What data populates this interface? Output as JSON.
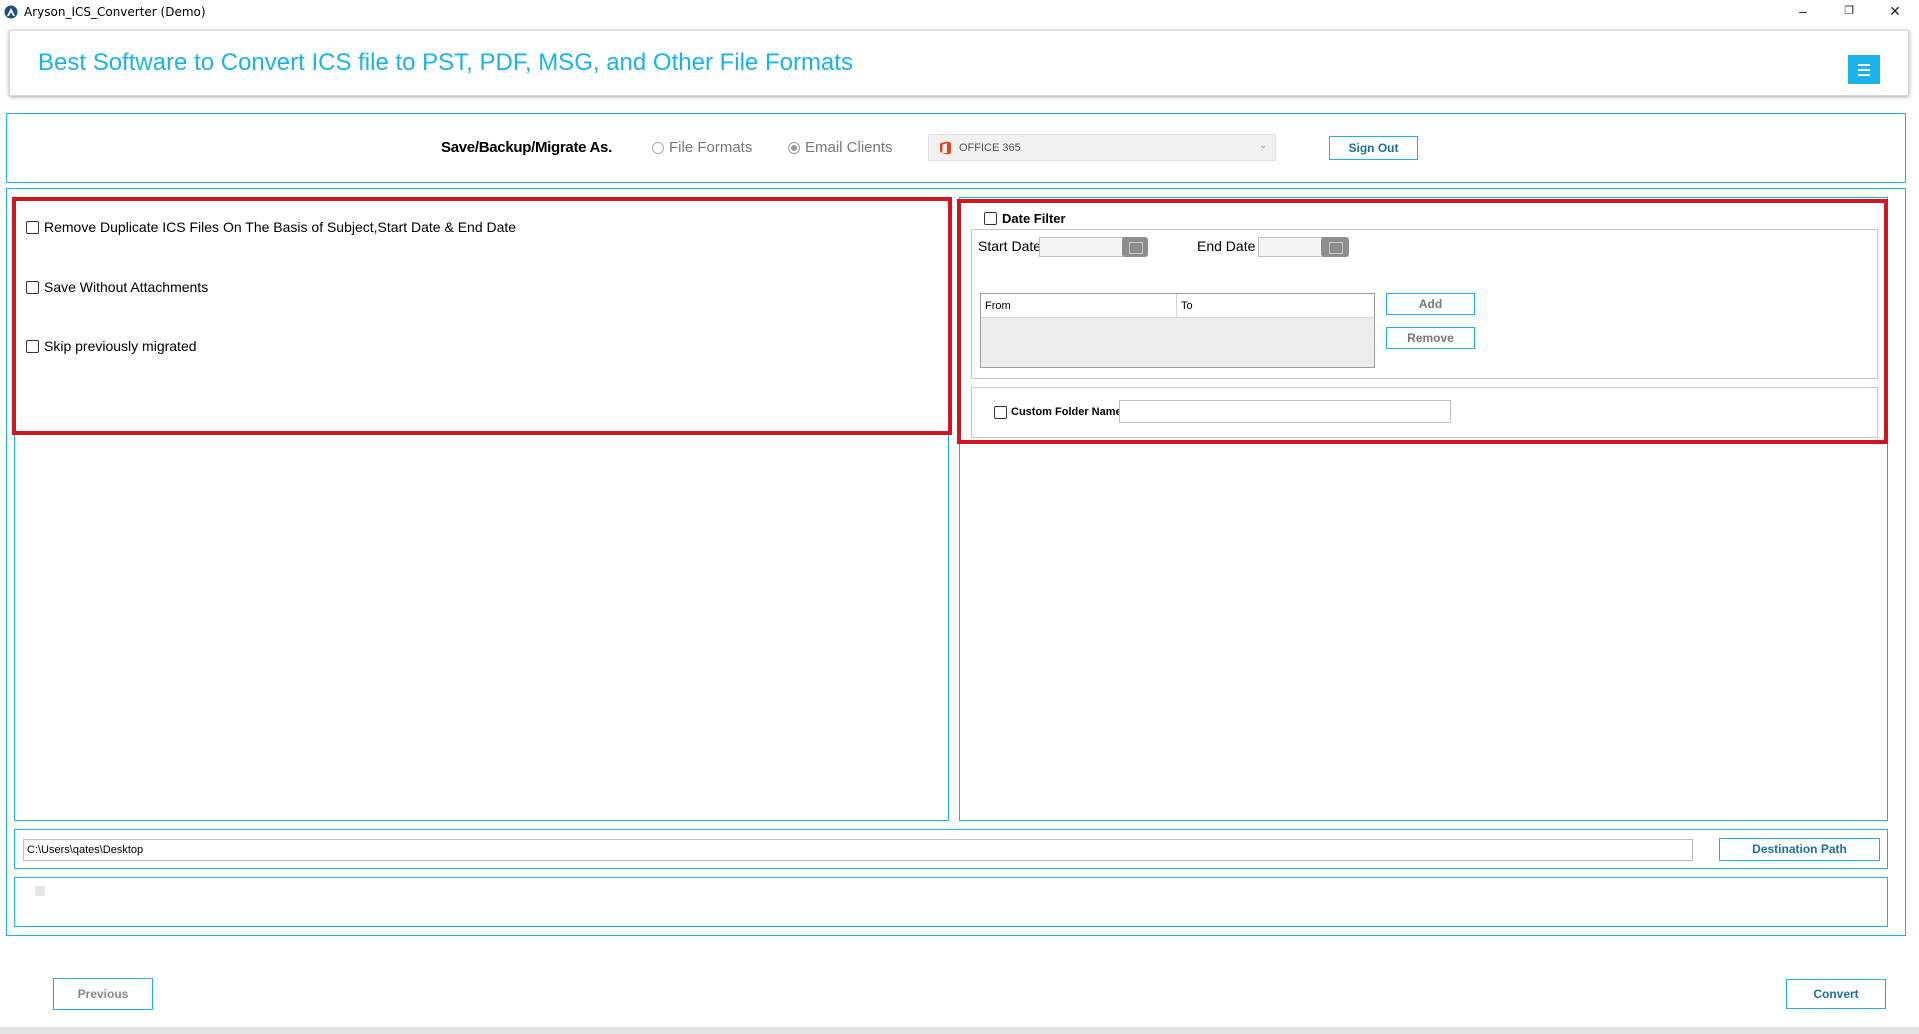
{
  "window": {
    "title": "Aryson_ICS_Converter (Demo)",
    "controls": {
      "minimize": "–",
      "restore": "❐",
      "close": "✕"
    }
  },
  "header": {
    "headline": "Best Software to Convert ICS file to PST, PDF, MSG, and Other File Formats",
    "accent_color": "#1ab3e6"
  },
  "save_bar": {
    "label": "Save/Backup/Migrate As.",
    "radio_file_formats": "File Formats",
    "radio_email_clients": "Email Clients",
    "selected_target": "OFFICE 365",
    "sign_out": "Sign Out"
  },
  "options": {
    "remove_duplicates": "Remove Duplicate ICS Files On The Basis of Subject,Start Date & End Date",
    "save_without_attachments": "Save Without Attachments",
    "skip_previously_migrated": "Skip previously migrated"
  },
  "date_filter": {
    "label": "Date Filter",
    "start_date_label": "Start Date :",
    "end_date_label": "End Date :",
    "table_headers": [
      "From",
      "To"
    ],
    "add_button": "Add",
    "remove_button": "Remove"
  },
  "custom_folder": {
    "label": "Custom Folder Name",
    "value": ""
  },
  "destination": {
    "path": "C:\\Users\\qates\\Desktop",
    "button": "Destination Path"
  },
  "footer": {
    "previous_button": "Previous",
    "convert_button": "Convert"
  },
  "colors": {
    "highlight_border": "#d0161f",
    "panel_border": "#1ab3e6",
    "office_icon": "#e0421e"
  }
}
